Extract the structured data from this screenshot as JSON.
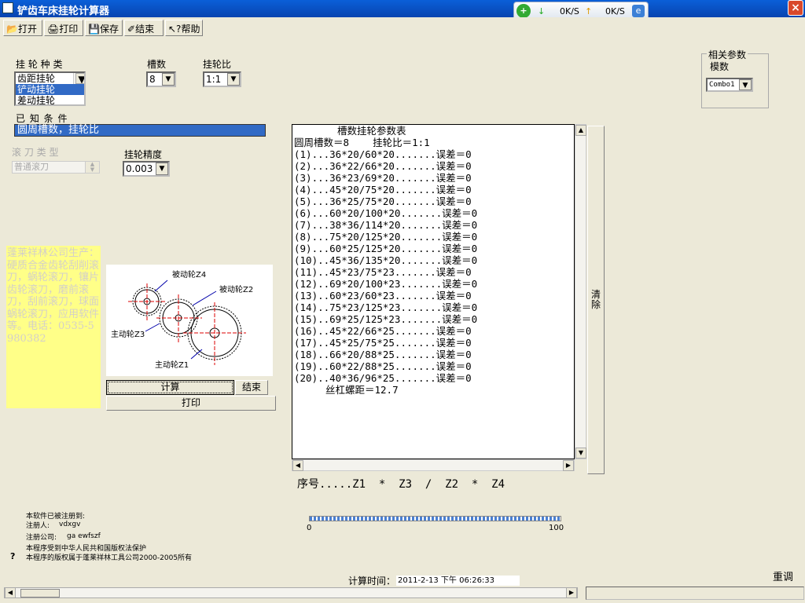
{
  "window": {
    "title": "铲齿车床挂轮计算器",
    "close_label": "×"
  },
  "netmon": {
    "down": "0K/S",
    "up": "0K/S"
  },
  "toolbar": {
    "open": "打开",
    "print": "打印",
    "save": "保存",
    "end": "结束",
    "help": "帮助"
  },
  "wheel_type": {
    "label": "挂 轮 种 类",
    "items": [
      "齿距挂轮",
      "铲动挂轮",
      "差动挂轮"
    ],
    "selected_index": 1
  },
  "slots": {
    "label": "槽数",
    "value": "8"
  },
  "ratio": {
    "label": "挂轮比",
    "value": "1:1"
  },
  "known": {
    "label": "已    知    条    件",
    "value": "圆周槽数，挂轮比"
  },
  "hob_type": {
    "label": "滚 刀 类 型",
    "value": "普通滚刀"
  },
  "precision": {
    "label": "挂轮精度",
    "value": "0.003"
  },
  "related": {
    "title": "相关参数",
    "modulus_label": "模数",
    "modulus_value": "Combo1"
  },
  "ad_text": "蓬莱祥林公司生产：硬质合金齿轮刮削滚刀，蜗轮滚刀，镶片齿轮滚刀，磨前滚刀，刮前滚刀，球面蜗轮滚刀，应用软件等。电话：0535-5980382",
  "diagram": {
    "z4": "被动轮Z4",
    "z2": "被动轮Z2",
    "z3": "主动轮Z3",
    "z1": "主动轮Z1"
  },
  "buttons": {
    "calc": "计算",
    "end": "结束",
    "print": "打印",
    "clear": "清除"
  },
  "table": {
    "title": "槽数挂轮参数表",
    "header": "圆周槽数＝8    挂轮比＝1:1",
    "rows": [
      "(1)...36*20/60*20.......误差＝0",
      "(2)...36*22/66*20.......误差＝0",
      "(3)...36*23/69*20.......误差＝0",
      "(4)...45*20/75*20.......误差＝0",
      "(5)...36*25/75*20.......误差＝0",
      "(6)...60*20/100*20.......误差＝0",
      "(7)...38*36/114*20.......误差＝0",
      "(8)...75*20/125*20.......误差＝0",
      "(9)...60*25/125*20.......误差＝0",
      "(10)..45*36/135*20.......误差＝0",
      "(11)..45*23/75*23.......误差＝0",
      "(12)..69*20/100*23.......误差＝0",
      "(13)..60*23/60*23.......误差＝0",
      "(14)..75*23/125*23.......误差＝0",
      "(15)..69*25/125*23.......误差＝0",
      "(16)..45*22/66*25.......误差＝0",
      "(17)..45*25/75*25.......误差＝0",
      "(18)..66*20/88*25.......误差＝0",
      "(19)..60*22/88*25.......误差＝0",
      "(20)..40*36/96*25.......误差＝0"
    ],
    "footer": "丝杠螺距＝12.7"
  },
  "seq_line": "序号.....Z1  *  Z3  /  Z2  *  Z4",
  "registration": {
    "line1": "本软件已被注册到:",
    "line2_label": "注册人:",
    "line2_value": "vdxgv",
    "line3_label": "注册公司:",
    "line3_value": "ga ewfszf",
    "line4": "本程序受到中华人民共和国版权法保护",
    "line5": "本程序的版权属于蓬莱祥林工具公司2000-2005所有",
    "question": "?"
  },
  "progress": {
    "min": "0",
    "max": "100",
    "fraction": 1.0
  },
  "calc_time": {
    "label": "计算时间：",
    "value": "2011-2-13 下午 06:26:33"
  },
  "redo": "重调"
}
